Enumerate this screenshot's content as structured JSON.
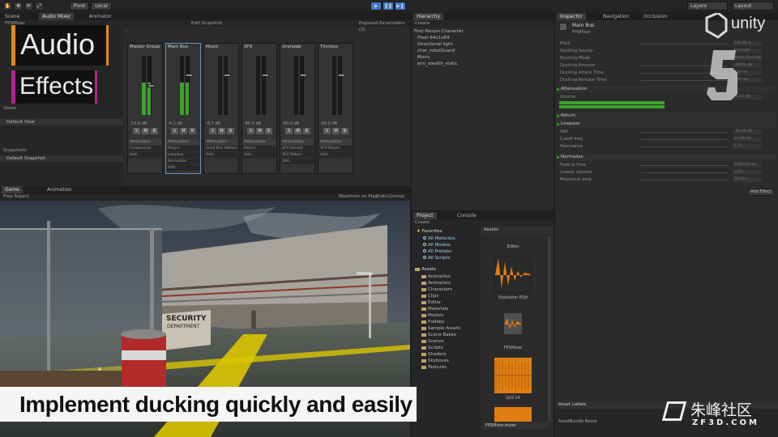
{
  "toolbar": {
    "tools": [
      "hand-tool",
      "move-tool",
      "rotate-tool",
      "scale-tool"
    ],
    "pivot": "Pivot",
    "local": "Local",
    "play_buttons": [
      "play",
      "pause",
      "step"
    ],
    "layers": "Layers",
    "layout": "Layout"
  },
  "mixer_panel": {
    "tabs": [
      "Scene",
      "Audio Mixer",
      "Animator"
    ],
    "mixer_name": "FPSMixer",
    "edit_snapshot": "Edit Snapshot",
    "exposed_params": "Exposed Parameters (3)",
    "views_header": "Views",
    "default_view": "Default View",
    "snapshots_header": "Snapshots",
    "default_snapshot": "Default Snapshot",
    "strips": [
      {
        "name": "Master Group",
        "db": "-13.0 dB",
        "level_left": 0.55,
        "level_right": 0.55,
        "fader": 0.52,
        "effects": [
          "Attenuation",
          "Compressor",
          "Add..."
        ],
        "selected": false
      },
      {
        "name": "Main Bus",
        "db": "-8.1 dB",
        "level_left": 0.55,
        "level_right": 0.55,
        "fader": 0.7,
        "effects": [
          "Attenuation",
          "Return",
          "Lowpass",
          "Normalize",
          "Add..."
        ],
        "selected": true
      },
      {
        "name": "Music",
        "db": "-8.7 dB",
        "level_left": 0.0,
        "level_right": 0.0,
        "fader": 0.7,
        "effects": [
          "Attenuation",
          "Send Bus (Return)",
          "Add..."
        ],
        "selected": false
      },
      {
        "name": "SFX",
        "db": "-80.0 dB",
        "level_left": 0.0,
        "level_right": 0.0,
        "fader": 0.7,
        "effects": [
          "Attenuation",
          "Return",
          "Add..."
        ],
        "selected": false
      },
      {
        "name": "Grenade",
        "db": "-80.0 dB",
        "level_left": 0.0,
        "level_right": 0.0,
        "fader": 0.7,
        "effects": [
          "Attenuation",
          "SFX Reverb",
          "SFX Return",
          "Add..."
        ],
        "selected": false
      },
      {
        "name": "Tinnitus",
        "db": "-80.0 dB",
        "level_left": 0.0,
        "level_right": 0.0,
        "fader": 0.7,
        "effects": [
          "Attenuation",
          "SFX Return",
          "Add..."
        ],
        "selected": false
      }
    ],
    "smb": [
      "S",
      "M",
      "B"
    ]
  },
  "hierarchy": {
    "tab": "Hierarchy",
    "create": "Create",
    "items": [
      "First Person Character",
      "Floor 64x1x64",
      "Directional light",
      "char_robotGuard",
      "Music",
      "env_stealth_static"
    ]
  },
  "inspector": {
    "tabs": [
      "Inspector",
      "Navigation",
      "Occlusion"
    ],
    "name": "Main Bus",
    "subname": "FPSMixer",
    "rows": [
      {
        "label": "Pitch",
        "value": "100.00 %"
      },
      {
        "label": "Ducking Source",
        "value": "Grenade"
      },
      {
        "label": "Ducking Mode",
        "value": "Audio Ducking"
      },
      {
        "label": "Ducking Amount",
        "value": "-40.00 dB"
      },
      {
        "label": "Ducking Attack Time",
        "value": "100 ms"
      },
      {
        "label": "Ducking Release Time",
        "value": "500 ms"
      }
    ],
    "attenuation": "Attenuation",
    "volume_label": "Volume",
    "volume_value": "-8.13 dB",
    "return_label": "Return",
    "lowpass_label": "Lowpass",
    "lowpass_rows": [
      {
        "label": "Wet",
        "value": "-80.00 dB"
      },
      {
        "label": "Cutoff freq",
        "value": "10.00 Hz"
      },
      {
        "label": "Resonance",
        "value": "1.15"
      }
    ],
    "normalize_label": "Normalize",
    "normalize_rows": [
      {
        "label": "Fade in time",
        "value": "5000.00 ms"
      },
      {
        "label": "Lowest volume",
        "value": "0.10"
      },
      {
        "label": "Maximum amp",
        "value": "20.00 x"
      }
    ],
    "add_effect": "Add Effect",
    "asset_labels": "Asset Labels",
    "assetbundle": "AssetBundle Name"
  },
  "game_panel": {
    "tabs": [
      "Game",
      "Animation"
    ],
    "aspect": "Free Aspect",
    "options": [
      "Maximize on Play",
      "Stats",
      "Gizmos"
    ]
  },
  "project": {
    "tabs": [
      "Project",
      "Console"
    ],
    "create": "Create",
    "favorites": "Favorites",
    "favorite_items": [
      "All Materials",
      "All Models",
      "All Prefabs",
      "All Scripts"
    ],
    "assets": "Assets",
    "asset_folders": [
      "Animation",
      "Animators",
      "Characters",
      "Clips",
      "Editor",
      "Materials",
      "Models",
      "Prefabs",
      "Sample Assets",
      "Scene Bakes",
      "Scenes",
      "Scripts",
      "Shaders",
      "Skyboxes",
      "Textures"
    ],
    "assets_header": "Assets",
    "thumbs": [
      "Editor",
      "Explosion EQd",
      "FPSMixer",
      "GOC14"
    ],
    "selected_file": "FPSMixer.mixer"
  },
  "overlay": {
    "title_line1": "Audio",
    "title_line2": "Effects",
    "caption": "Implement ducking quickly and easily",
    "unity_logo": "unity",
    "unity_version": "5",
    "watermark_cn": "朱峰社区",
    "watermark_url": "ZF3D.COM"
  },
  "colors": {
    "meter_green": "#3fa12f",
    "play_blue": "#3c78c8",
    "title_orange": "#e08a1e",
    "title_magenta": "#b0258f",
    "asset_orange": "#e07e10"
  }
}
